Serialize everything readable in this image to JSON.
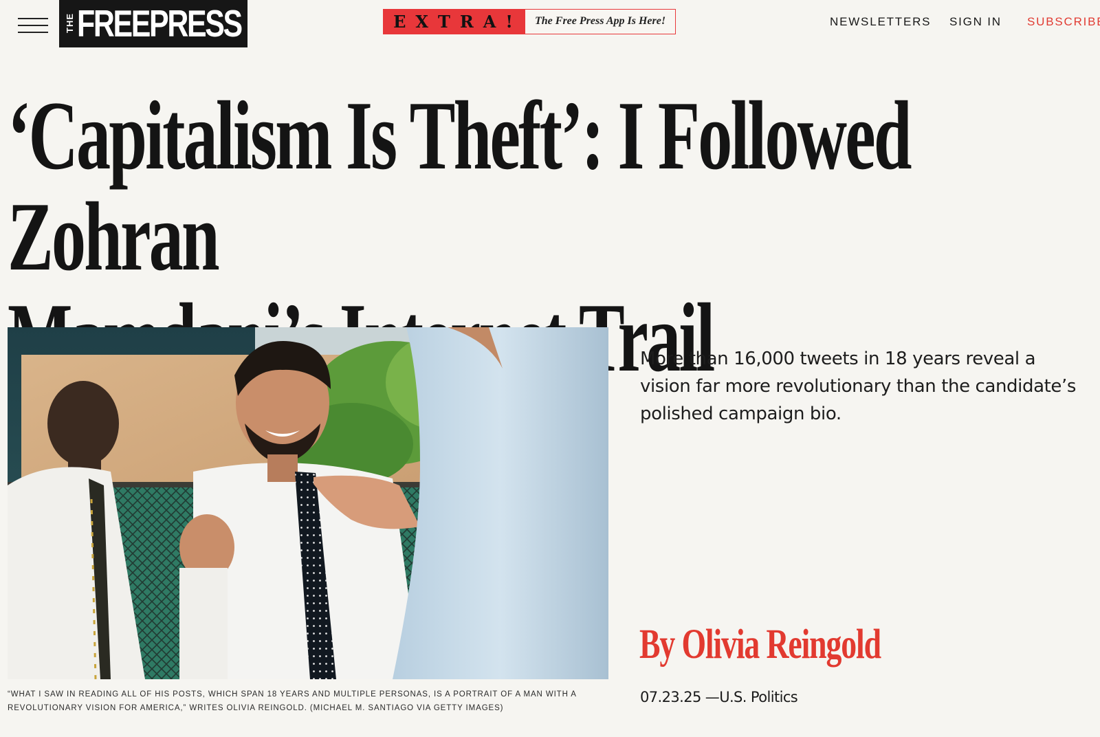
{
  "header": {
    "logo_the": "THE",
    "logo_name": "FREEPRESS",
    "extra_tag": "EXTRA!",
    "extra_message": "The Free Press App Is Here!",
    "nav": {
      "newsletters": "NEWSLETTERS",
      "sign_in": "SIGN IN",
      "subscribe": "SUBSCRIBE"
    }
  },
  "article": {
    "headline_line1": "‘Capitalism Is Theft’: I Followed Zohran",
    "headline_line2": "Mamdani’s Internet Trail",
    "dek": "More than 16,000 tweets in 18 years reveal a vision far more revolutionary than the candidate’s polished campaign bio.",
    "byline_prefix": "By",
    "author": "Olivia Reingold",
    "date": "07.23.25",
    "separator": "—",
    "section": "U.S. Politics",
    "image_caption": "“What I saw in reading all of his posts, which span 18 years and multiple personas, is a portrait of a man with a revolutionary vision for America,” writes Olivia Reingold. (Michael M. Santiago via Getty Images)"
  },
  "colors": {
    "background": "#f6f5f1",
    "accent_red": "#e23a30",
    "logo_black": "#161616",
    "text": "#141414"
  },
  "icons": {
    "menu": "hamburger-menu-icon"
  }
}
